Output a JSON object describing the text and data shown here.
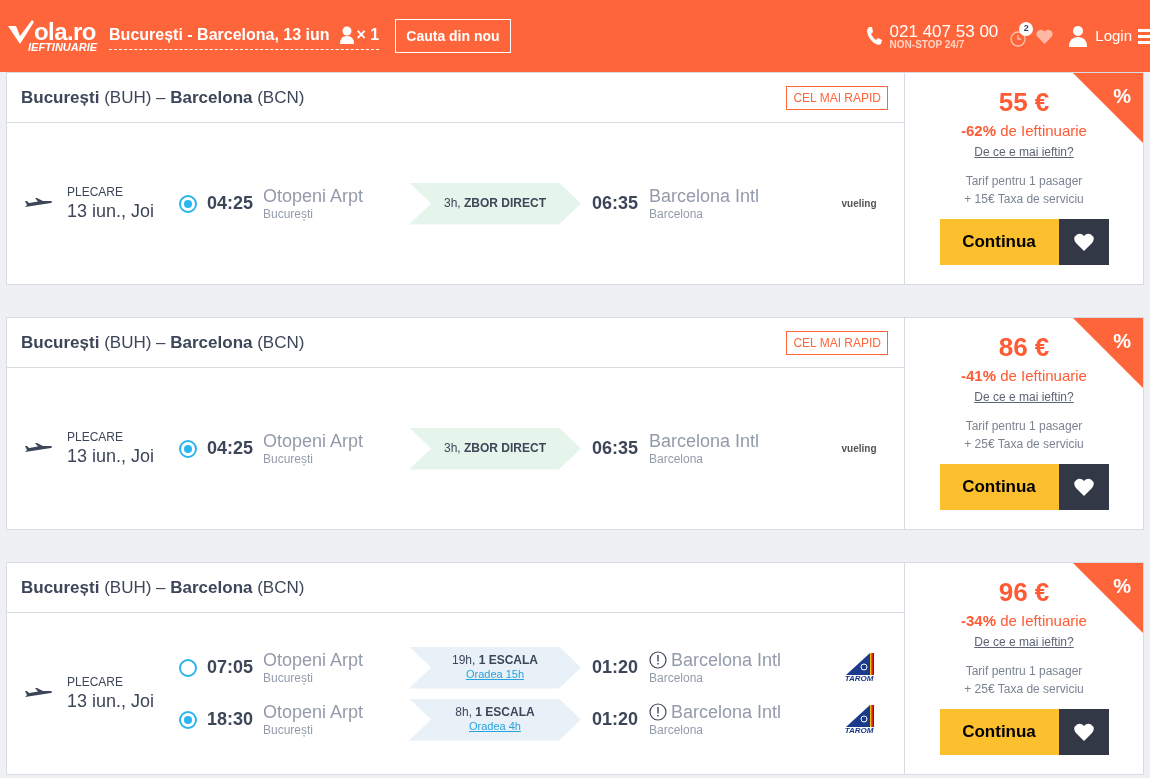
{
  "header": {
    "logo": {
      "text": "ola.ro",
      "tagline": "IEFTINUARIE"
    },
    "route": "București - Barcelona, 13 iun",
    "passengers": "× 1",
    "search_again": "Cauta din nou",
    "phone": "021 407 53 00",
    "phone_hours": "NON-STOP 24/7",
    "history_count": "2",
    "login": "Login"
  },
  "results": [
    {
      "title": "**București** (BUH) – **Barcelona** (BCN)",
      "badge": "CEL MAI RAPID",
      "departure_label": "PLECARE",
      "date": "13 iun., Joi",
      "segments": [
        {
          "selected": true,
          "dep_time": "04:25",
          "dep_airport": "Otopeni Arpt",
          "dep_city": "București",
          "duration": "3h, **ZBOR DIRECT**",
          "kind": "direct",
          "arr_time": "06:35",
          "arr_airport": "Barcelona Intl",
          "arr_city": "Barcelona",
          "warning": false,
          "airline": {
            "name": "vueling",
            "kind": "wordmark"
          }
        }
      ],
      "price": "55 €",
      "discount": "**-62%** de Ieftinuarie",
      "why": "De ce e mai ieftin?",
      "fare_note": "Tarif pentru 1 pasager",
      "fee": "+ 15€ Taxa de serviciu",
      "cta": "Continua",
      "corner": "%"
    },
    {
      "title": "**București** (BUH) – **Barcelona** (BCN)",
      "badge": "CEL MAI RAPID",
      "departure_label": "PLECARE",
      "date": "13 iun., Joi",
      "segments": [
        {
          "selected": true,
          "dep_time": "04:25",
          "dep_airport": "Otopeni Arpt",
          "dep_city": "București",
          "duration": "3h, **ZBOR DIRECT**",
          "kind": "direct",
          "arr_time": "06:35",
          "arr_airport": "Barcelona Intl",
          "arr_city": "Barcelona",
          "warning": false,
          "airline": {
            "name": "vueling",
            "kind": "wordmark"
          }
        }
      ],
      "price": "86 €",
      "discount": "**-41%** de Ieftinuarie",
      "why": "De ce e mai ieftin?",
      "fare_note": "Tarif pentru 1 pasager",
      "fee": "+ 25€ Taxa de serviciu",
      "cta": "Continua",
      "corner": "%"
    },
    {
      "title": "**București** (BUH) – **Barcelona** (BCN)",
      "departure_label": "PLECARE",
      "date": "13 iun., Joi",
      "segments": [
        {
          "selected": false,
          "dep_time": "07:05",
          "dep_airport": "Otopeni Arpt",
          "dep_city": "București",
          "duration": "19h, **1 ESCALA**",
          "stop_info": "Oradea 15h",
          "kind": "stop",
          "arr_time": "01:20",
          "arr_airport": "Barcelona Intl",
          "arr_city": "Barcelona",
          "warning": true,
          "airline": {
            "name": "TAROM",
            "kind": "tail"
          }
        },
        {
          "selected": true,
          "dep_time": "18:30",
          "dep_airport": "Otopeni Arpt",
          "dep_city": "București",
          "duration": "8h, **1 ESCALA**",
          "stop_info": "Oradea 4h",
          "kind": "stop",
          "arr_time": "01:20",
          "arr_airport": "Barcelona Intl",
          "arr_city": "Barcelona",
          "warning": true,
          "airline": {
            "name": "TAROM",
            "kind": "tail"
          }
        }
      ],
      "price": "96 €",
      "discount": "**-34%** de Ieftinuarie",
      "why": "De ce e mai ieftin?",
      "fare_note": "Tarif pentru 1 pasager",
      "fee": "+ 25€ Taxa de serviciu",
      "cta": "Continua",
      "corner": "%"
    }
  ]
}
